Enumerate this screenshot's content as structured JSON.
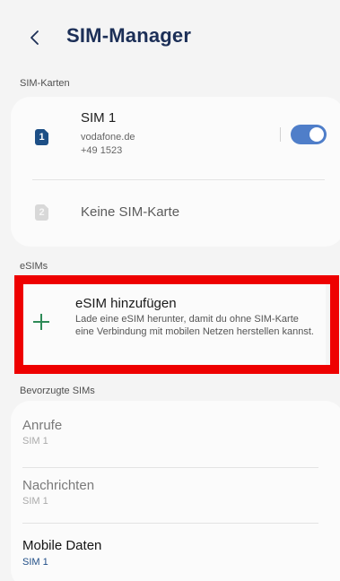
{
  "header": {
    "title": "SIM-Manager",
    "back_icon": "chevron-left-icon"
  },
  "sim_cards": {
    "section_label": "SIM-Karten",
    "sim1": {
      "badge": "1",
      "name": "SIM 1",
      "carrier": "vodafone.de",
      "number": "+49 1523",
      "toggle_on": true,
      "badge_color": "#1d4f86",
      "toggle_color": "#4f7ec9"
    },
    "sim2": {
      "badge": "2",
      "label": "Keine SIM-Karte"
    }
  },
  "esims": {
    "section_label": "eSIMs",
    "add": {
      "icon": "plus-icon",
      "title": "eSIM hinzufügen",
      "description": "Lade eine eSIM herunter, damit du ohne SIM-Karte eine Verbindung mit mobilen Netzen herstellen kannst."
    },
    "highlight_color": "#ee0000"
  },
  "preferred": {
    "section_label": "Bevorzugte SIMs",
    "items": [
      {
        "title": "Anrufe",
        "value": "SIM 1"
      },
      {
        "title": "Nachrichten",
        "value": "SIM 1"
      },
      {
        "title": "Mobile Daten",
        "value": "SIM 1"
      }
    ]
  }
}
